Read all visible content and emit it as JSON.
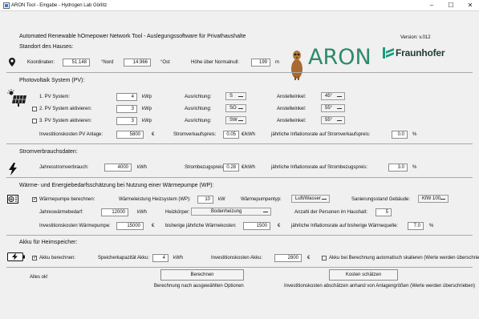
{
  "window": {
    "title": "ARON Tool - Eingabe  -  Hydrogen Lab Görlitz",
    "controls": {
      "minimize": "–",
      "maximize": "☐",
      "close": "✕"
    }
  },
  "header": {
    "app_title": "Automated Renewable hOmepower Network Tool - Auslegungssoftware für Privathaushalte",
    "version": "Version: v.012",
    "logo_aron": "ARON",
    "logo_fraunhofer": "Fraunhofer"
  },
  "location": {
    "heading": "Standort des Hauses:",
    "coords_label": "Koordinaten:",
    "lat": "51.148",
    "lat_unit": "°Nord",
    "lon": "14.966",
    "lon_unit": "°Ost",
    "alt_label": "Höhe über Normalnull:",
    "alt": "199",
    "alt_unit": "m"
  },
  "pv": {
    "heading": "Photovoltaik System (PV):",
    "systems": [
      {
        "label": "1. PV System:",
        "kwp": "4",
        "unit": "kWp",
        "orient_label": "Ausrichtung:",
        "orient": "S",
        "angle_label": "Anstellwinkel:",
        "angle": "45°"
      },
      {
        "label": "2. PV System aktivieren:",
        "kwp": "3",
        "unit": "kWp",
        "orient_label": "Ausrichtung:",
        "orient": "SO",
        "angle_label": "Anstellwinkel:",
        "angle": "55°"
      },
      {
        "label": "3. PV System aktivieren:",
        "kwp": "3",
        "unit": "kWp",
        "orient_label": "Ausrichtung:",
        "orient": "SW",
        "angle_label": "Anstellwinkel:",
        "angle": "55°"
      }
    ],
    "invest_label": "Investitionskosten PV Anlage:",
    "invest": "5800",
    "invest_unit": "€",
    "sell_label": "Stromverkaufspreis:",
    "sell": "0.05",
    "sell_unit": "€/kWh",
    "infl_label": "jährliche Inflationsrate auf Stromverkaufspreis:",
    "infl": "0.0",
    "infl_unit": "%"
  },
  "power": {
    "heading": "Stromverbrauchsdaten:",
    "usage_label": "Jahresstromverbrauch:",
    "usage": "4000",
    "usage_unit": "kWh",
    "price_label": "Strombezugspreis:",
    "price": "0.28",
    "price_unit": "€/kWh",
    "infl_label": "jährliche Inflationsrate auf Strombezugspreis:",
    "infl": "3.0",
    "infl_unit": "%"
  },
  "heat": {
    "heading": "Wärme- und Energiebedarfsschätzung bei Nutzung einer Wärmepumpe (WP):",
    "hp_label": "Wärmepumpe berechnen:",
    "power_label": "Wärmeleistung Heizsystem (WP):",
    "power": "10",
    "power_unit": "kW",
    "type_label": "Wärmepumpentyp:",
    "type": "Luft/Wasser",
    "renov_label": "Sanierungsstand Gebäude:",
    "renov": "KfW 100",
    "demand_label": "Jahreswärmebedarf:",
    "demand": "12000",
    "demand_unit": "kWh",
    "heater_label": "Heizkörper:",
    "heater": "Bodenheizung",
    "persons_label": "Anzahl der Personen im Haushalt:",
    "persons": "5",
    "invest_label": "Investitionskosten Wärmepumpe:",
    "invest": "15000",
    "invest_unit": "€",
    "cost_label": "bisherige jährliche Wärmekosten:",
    "cost": "1500",
    "cost_unit": "€",
    "infl_label": "jährliche Inflationsrate auf bisherige Wärmequelle:",
    "infl": "7.0",
    "infl_unit": "%"
  },
  "battery": {
    "heading": "Akku für Heimspeicher:",
    "calc_label": "Akku berechnen:",
    "cap_label": "Speicherkapazität Akku:",
    "cap": "4",
    "cap_unit": "kWh",
    "invest_label": "Investitionskosten Akku:",
    "invest": "2800",
    "invest_unit": "€",
    "auto_label": "Akku bei Berechnung automatisch skalieren (Werte werden überschrieben)"
  },
  "footer": {
    "status": "Alles ok!",
    "calc_button": "Berechnen",
    "calc_caption": "Berechnung nach ausgewählten Optionen",
    "estimate_button": "Kosten schätzen",
    "estimate_caption": "Investitionskosten abschätzen anhand von Anlagengrößen (Werte werden überschrieben)"
  },
  "colors": {
    "aron_green": "#2d8b6a",
    "fraunhofer_green": "#179c7d",
    "window_bg": "#f0f0f0"
  }
}
